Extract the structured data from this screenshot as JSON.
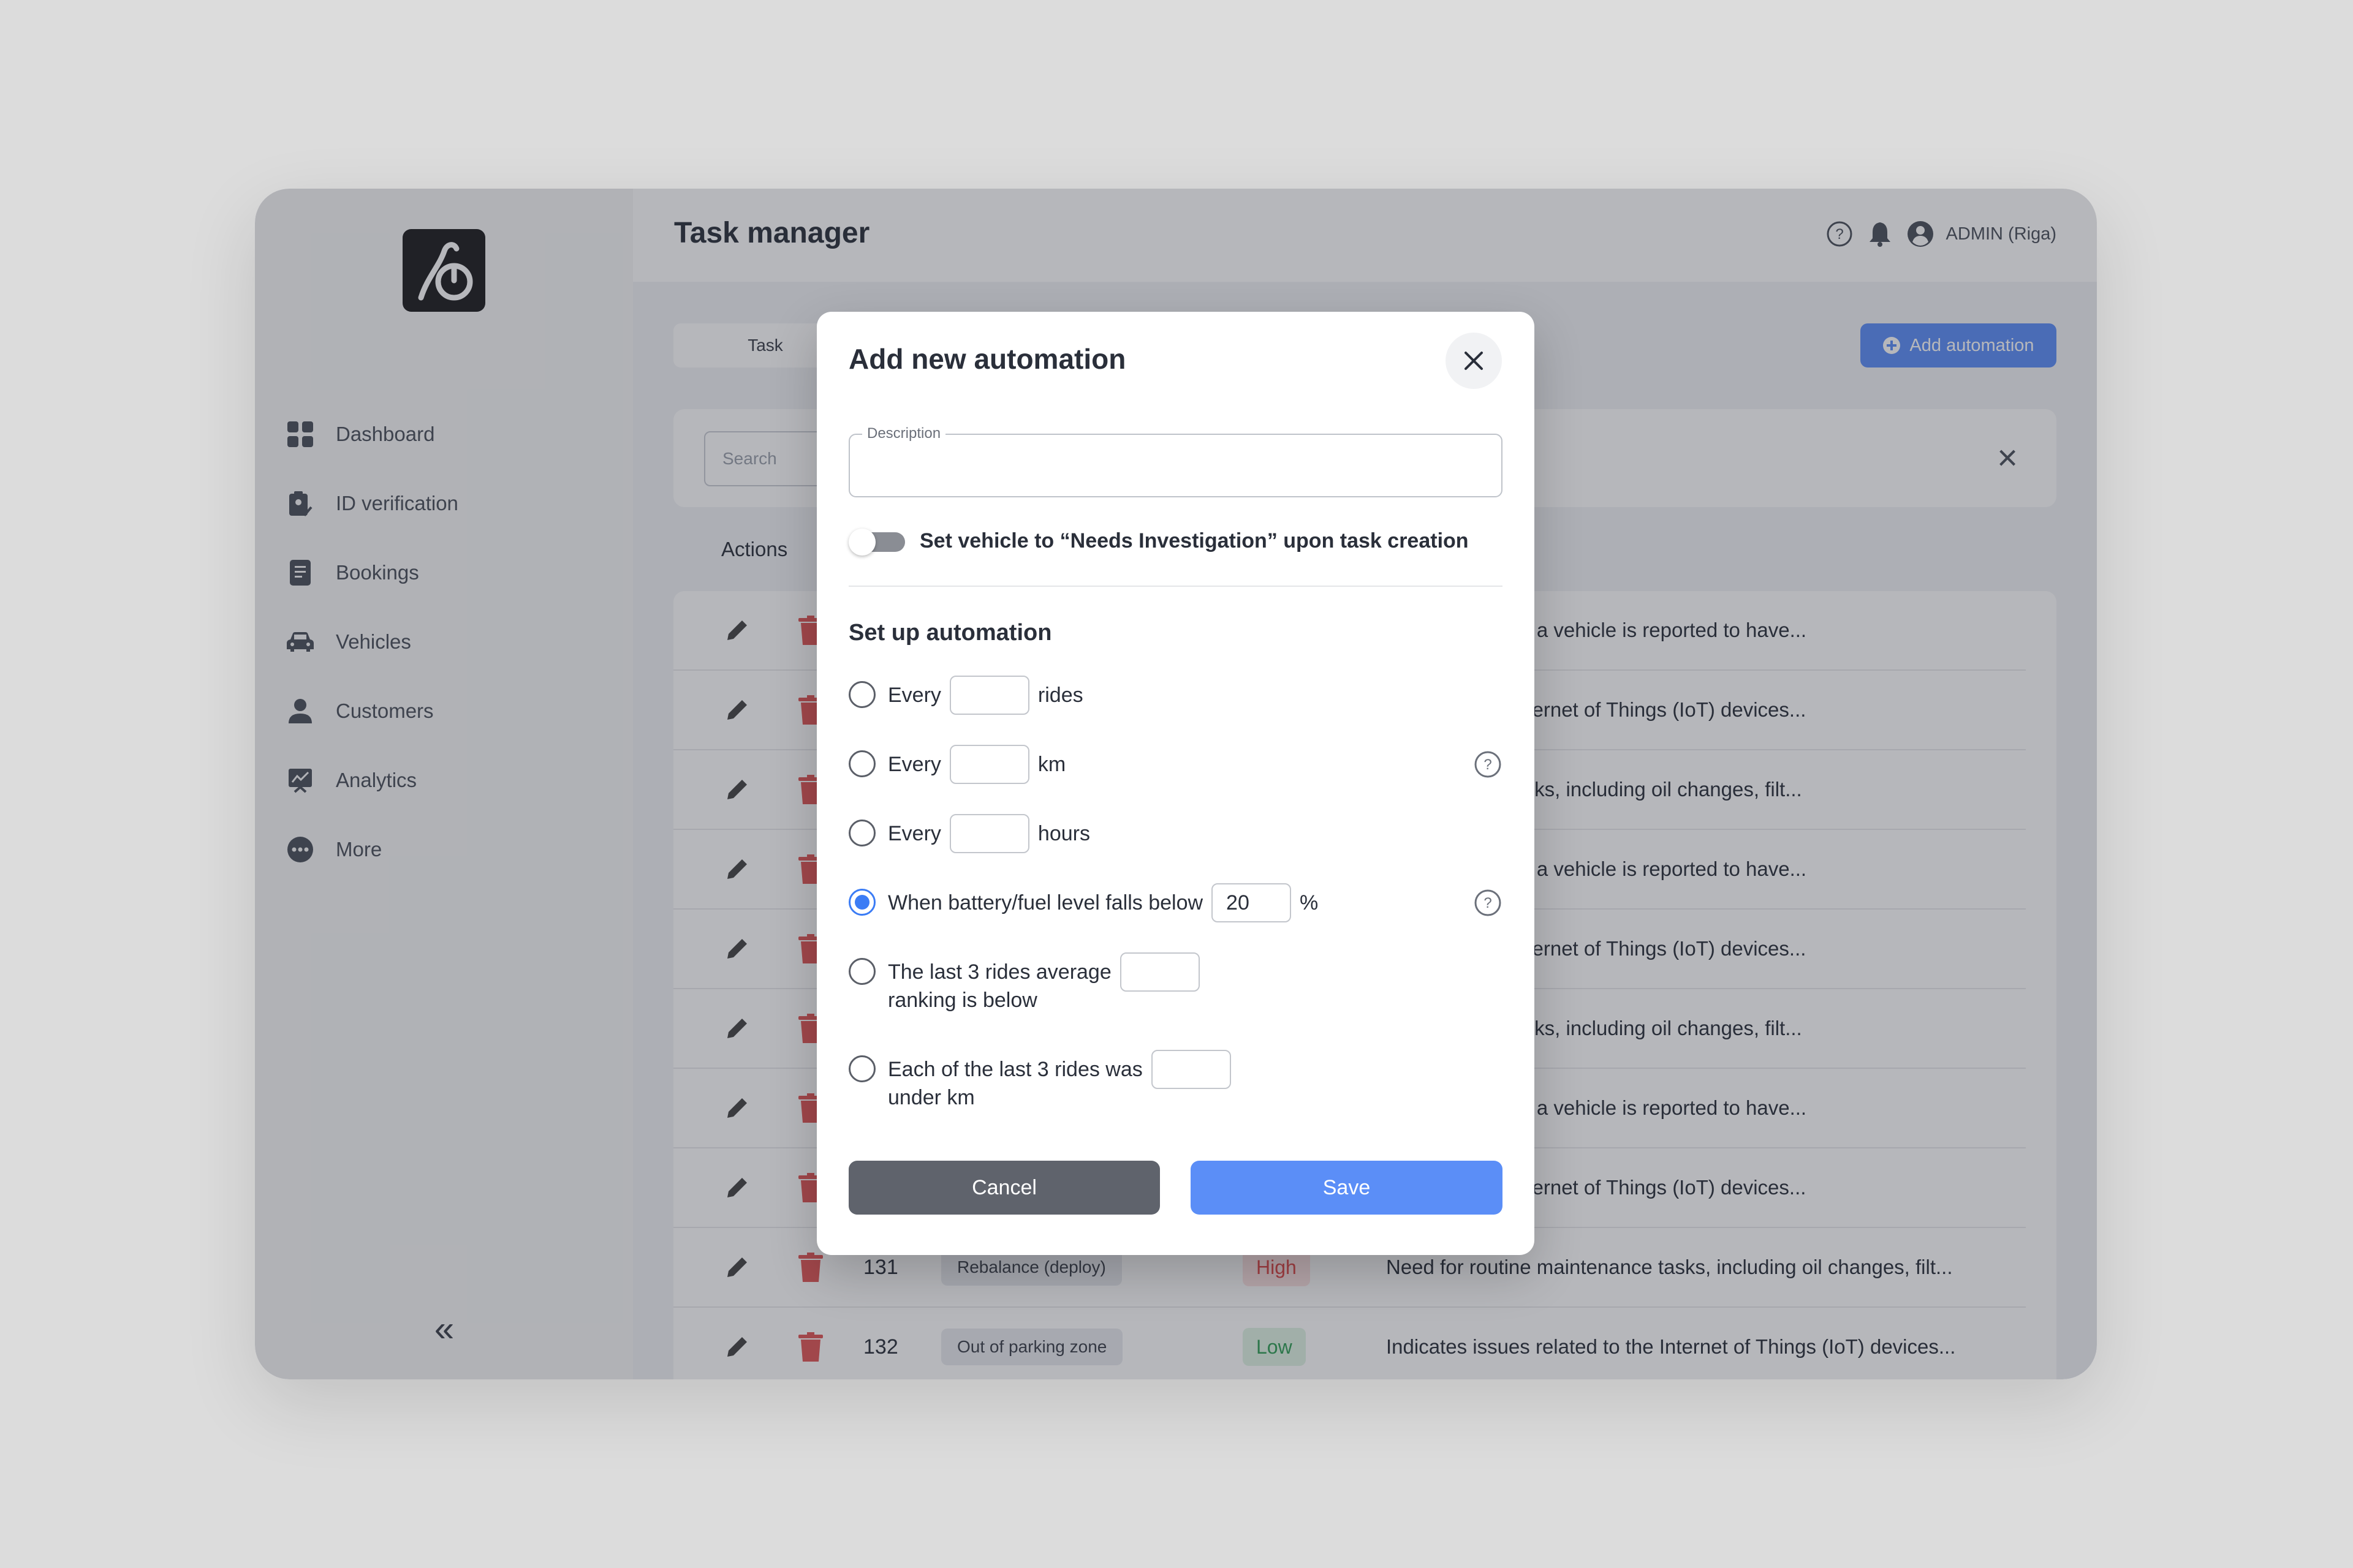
{
  "app": {
    "title": "Task manager",
    "user": "ADMIN (Riga)"
  },
  "sidebar": {
    "items": [
      {
        "label": "Dashboard",
        "icon": "dashboard-icon"
      },
      {
        "label": "ID verification",
        "icon": "id-verification-icon"
      },
      {
        "label": "Bookings",
        "icon": "bookings-icon"
      },
      {
        "label": "Vehicles",
        "icon": "car-icon"
      },
      {
        "label": "Customers",
        "icon": "person-icon"
      },
      {
        "label": "Analytics",
        "icon": "analytics-icon"
      },
      {
        "label": "More",
        "icon": "more-icon"
      }
    ],
    "collapse": "«"
  },
  "main": {
    "tab_label": "Task",
    "add_button": "Add automation",
    "search_placeholder": "Search",
    "actions_header": "Actions",
    "rows": [
      {
        "desc": "generated when a vehicle is reported to have..."
      },
      {
        "desc": "related to the Internet of Things (IoT) devices..."
      },
      {
        "desc": "maintenance tasks, including oil changes, filt..."
      },
      {
        "desc": "generated when a vehicle is reported to have..."
      },
      {
        "desc": "related to the Internet of Things (IoT) devices..."
      },
      {
        "desc": "maintenance tasks, including oil changes, filt..."
      },
      {
        "desc": "generated when a vehicle is reported to have..."
      },
      {
        "desc": "related to the Internet of Things (IoT) devices..."
      },
      {
        "id": "131",
        "type": "Rebalance (deploy)",
        "priority": "High",
        "desc": "Need for routine maintenance tasks, including oil changes, filt..."
      },
      {
        "id": "132",
        "type": "Out of parking zone",
        "priority": "Low",
        "desc": "Indicates issues related to the Internet of Things (IoT) devices..."
      }
    ]
  },
  "modal": {
    "title": "Add new automation",
    "description_label": "Description",
    "description_value": "",
    "toggle_label": "Set vehicle to “Needs Investigation” upon task creation",
    "toggle_on": false,
    "section_title": "Set up automation",
    "options": [
      {
        "before": "Every",
        "value": "",
        "after": "rides",
        "selected": false
      },
      {
        "before": "Every",
        "value": "",
        "after": "km",
        "selected": false
      },
      {
        "before": "Every",
        "value": "",
        "after": "hours",
        "selected": false
      },
      {
        "before": "When battery/fuel level falls below",
        "value": "20",
        "after": "%",
        "selected": true
      },
      {
        "line1": "The last 3 rides average",
        "line2": "ranking is below",
        "value": "",
        "selected": false
      },
      {
        "line1": "Each of the last 3 rides was",
        "line2": "under km",
        "value": "",
        "selected": false
      }
    ],
    "cancel": "Cancel",
    "save": "Save"
  },
  "colors": {
    "accent": "#5b8ef7",
    "radio_selected": "#3b7cf5",
    "cancel_bg": "#5f636c",
    "priority_high": "#e04848",
    "priority_low": "#2f9e55",
    "delete_icon": "#e05555"
  }
}
